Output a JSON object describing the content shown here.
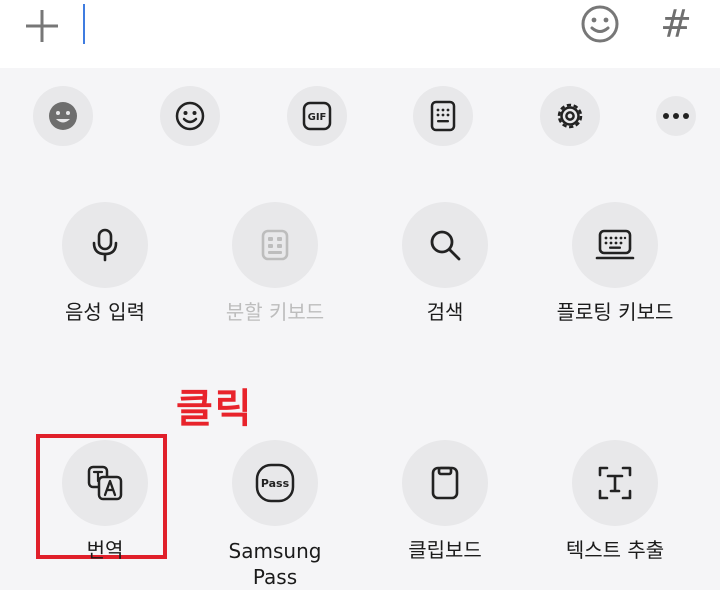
{
  "input_bar": {
    "add_icon": "plus-icon",
    "emoji_icon": "smiley-icon",
    "hash_label": "#"
  },
  "toolbar": {
    "items": [
      {
        "name": "bitmoji",
        "icon": "face-sticker-icon"
      },
      {
        "name": "emoji",
        "icon": "smiley-icon"
      },
      {
        "name": "gif",
        "icon": "gif-icon",
        "text": "GIF"
      },
      {
        "name": "keyboard-layout",
        "icon": "keypad-icon"
      },
      {
        "name": "settings",
        "icon": "gear-icon"
      },
      {
        "name": "more",
        "icon": "more-icon"
      }
    ]
  },
  "grid": {
    "row1": [
      {
        "label": "음성 입력",
        "icon": "microphone-icon",
        "enabled": true
      },
      {
        "label": "분할 키보드",
        "icon": "split-keyboard-icon",
        "enabled": false
      },
      {
        "label": "검색",
        "icon": "search-icon",
        "enabled": true
      },
      {
        "label": "플로팅 키보드",
        "icon": "floating-keyboard-icon",
        "enabled": true
      }
    ],
    "row2": [
      {
        "label": "번역",
        "icon": "translate-icon",
        "enabled": true
      },
      {
        "label_line1": "Samsung",
        "label_line2": "Pass",
        "icon_text": "Pass",
        "icon": "samsung-pass-icon",
        "enabled": true
      },
      {
        "label": "클립보드",
        "icon": "clipboard-icon",
        "enabled": true
      },
      {
        "label": "텍스트 추출",
        "icon": "text-extract-icon",
        "enabled": true
      }
    ]
  },
  "annotation": {
    "click_label": "클릭",
    "highlight_color": "#e01f2a"
  }
}
